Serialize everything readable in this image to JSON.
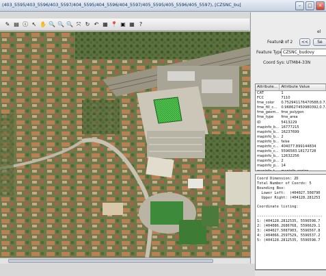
{
  "window": {
    "title": "(403_5595/403_5596/403_5597/404_5595/404_5596/404_5597/405_5595/405_5596/405_5597), [CZSNC_bu]",
    "min_label": "–",
    "max_label": "□",
    "close_label": "×"
  },
  "toolbar": {
    "icons": [
      "pencil-icon",
      "page-icon",
      "info-icon",
      "pointer-icon",
      "hand-icon",
      "zoom-in-icon",
      "zoom-out-icon",
      "zoom-area-icon",
      "zoom-extent-icon",
      "refresh-icon",
      "back-icon",
      "table-icon",
      "pin-icon",
      "measure-icon",
      "help-icon",
      "question-icon"
    ],
    "glyphs": [
      "✎",
      "▤",
      "ⓘ",
      "↖",
      "✋",
      "🔍",
      "🔍",
      "🔍",
      "⤧",
      "↻",
      "↶",
      "▦",
      "📍",
      "▣",
      "▦",
      "?"
    ]
  },
  "panel": {
    "corner_label": "el",
    "feature_label": "Feature:",
    "feature_value": "2 of 2",
    "prev_btn": "<<",
    "next_btn": "Se",
    "feature_type_label": "Feature Type:",
    "feature_type_value": "CZSNC_budovy",
    "coord_sys_label": "Coord Sys: UTM84-33N",
    "columns": [
      "Attribute...",
      "Attribute Value"
    ],
    "attributes": [
      [
        "CAT",
        "1"
      ],
      [
        "FCC",
        "7110"
      ],
      [
        "fme_color",
        "0.752941176470588,0.7..."
      ],
      [
        "fme_fill_c...",
        "0.968627450980392,0.7..."
      ],
      [
        "fme_geom...",
        "fme_polygon"
      ],
      [
        "fme_type",
        "fme_area"
      ],
      [
        "ID",
        "5413229"
      ],
      [
        "mapinfo_b...",
        "16777215"
      ],
      [
        "mapinfo_b...",
        "16237699"
      ],
      [
        "mapinfo_b...",
        "2"
      ],
      [
        "mapinfo_b...",
        "false"
      ],
      [
        "mapinfo_c...",
        "404077.899144834"
      ],
      [
        "mapinfo_c...",
        "5596583.18172728"
      ],
      [
        "mapinfo_b...",
        "12632256"
      ],
      [
        "mapinfo_p...",
        "2"
      ],
      [
        "mapinfo_p...",
        "14"
      ],
      [
        "mapinfo_t...",
        "mapinfo_region"
      ]
    ]
  },
  "console": {
    "lines": [
      "Coord Dimension: 2D",
      "Total Number of Coords: 5",
      "Bounding Box:",
      "  Lower Left:  (404027.508790",
      "  Upper Right: (404128.281253",
      "",
      "Coordinate listing:",
      "",
      "------------------------------",
      "1: (404128.2812535, 5596598.7",
      "2: (404086.2686768, 5596629.1",
      "3: (404027.5087903, 5596567.8",
      "4: (404066.2597529, 5596537.2",
      "5: (404128.2812535, 5596598.7"
    ]
  },
  "colors": {
    "title_bg": "#c7d3e3",
    "selected_building": "#35b535",
    "map_base": "#8d8a63"
  }
}
